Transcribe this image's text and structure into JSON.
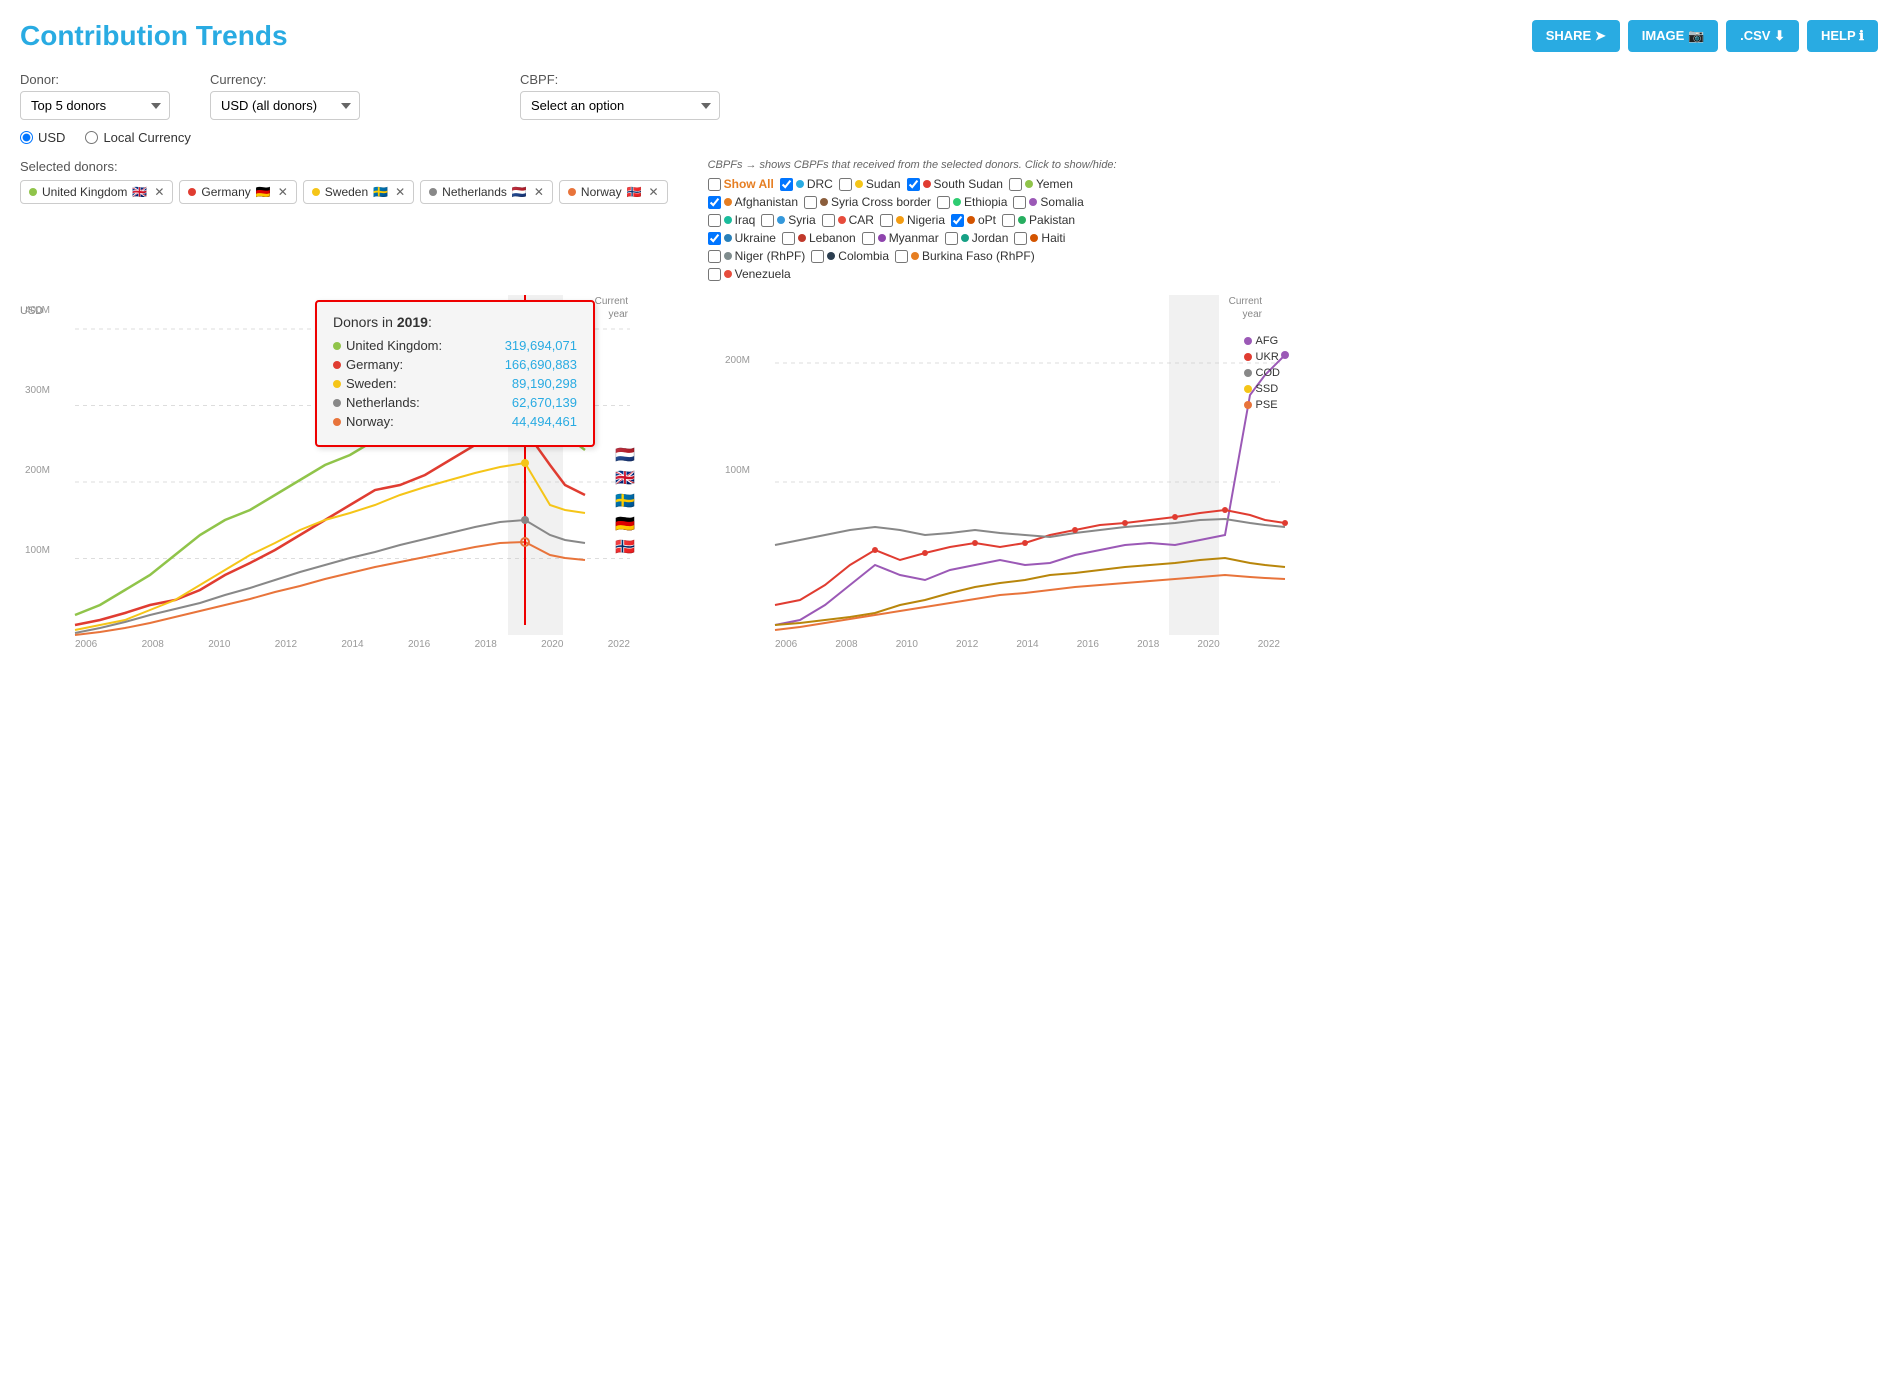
{
  "page": {
    "title": "Contribution Trends"
  },
  "header_buttons": [
    {
      "label": "SHARE",
      "icon": "share-icon",
      "name": "share-button"
    },
    {
      "label": "IMAGE",
      "icon": "image-icon",
      "name": "image-button"
    },
    {
      "label": ".CSV",
      "icon": "csv-icon",
      "name": "csv-button"
    },
    {
      "label": "HELP",
      "icon": "help-icon",
      "name": "help-button"
    }
  ],
  "controls": {
    "donor_label": "Donor:",
    "donor_value": "Top 5 donors",
    "currency_label": "Currency:",
    "currency_value": "USD (all donors)",
    "cbpf_label": "CBPF:",
    "cbpf_placeholder": "Select an option"
  },
  "radio": {
    "usd_label": "USD",
    "local_label": "Local Currency",
    "selected": "USD"
  },
  "selected_donors": {
    "label": "Selected donors:",
    "items": [
      {
        "name": "United Kingdom",
        "color": "#90C44A",
        "flag": "🇬🇧"
      },
      {
        "name": "Germany",
        "color": "#E03C31",
        "flag": "🇩🇪"
      },
      {
        "name": "Sweden",
        "color": "#F5C518",
        "flag": "🇸🇪"
      },
      {
        "name": "Netherlands",
        "color": "#888888",
        "flag": "🇳🇱"
      },
      {
        "name": "Norway",
        "color": "#E8743B",
        "flag": "🇳🇴"
      }
    ]
  },
  "cbpfs_section": {
    "label": "CBPFs → shows CBPFs that received from the selected donors. Click to show/hide:",
    "show_all_label": "Show All",
    "items": [
      {
        "name": "DRC",
        "color": "#29ABE2",
        "checked": true
      },
      {
        "name": "Sudan",
        "color": "#F5C518",
        "checked": false
      },
      {
        "name": "South Sudan",
        "color": "#E03C31",
        "checked": true
      },
      {
        "name": "Yemen",
        "color": "#90C44A",
        "checked": false
      },
      {
        "name": "Afghanistan",
        "color": "#E67E22",
        "checked": true
      },
      {
        "name": "Syria Cross border",
        "color": "#8B5E3C",
        "checked": false
      },
      {
        "name": "Ethiopia",
        "color": "#2ECC71",
        "checked": false
      },
      {
        "name": "Somalia",
        "color": "#9B59B6",
        "checked": false
      },
      {
        "name": "Iraq",
        "color": "#1ABC9C",
        "checked": false
      },
      {
        "name": "Syria",
        "color": "#3498DB",
        "checked": false
      },
      {
        "name": "CAR",
        "color": "#E74C3C",
        "checked": false
      },
      {
        "name": "Nigeria",
        "color": "#F39C12",
        "checked": false
      },
      {
        "name": "oPt",
        "color": "#D35400",
        "checked": true
      },
      {
        "name": "Pakistan",
        "color": "#27AE60",
        "checked": false
      },
      {
        "name": "Ukraine",
        "color": "#2980B9",
        "checked": true
      },
      {
        "name": "Lebanon",
        "color": "#C0392B",
        "checked": false
      },
      {
        "name": "Myanmar",
        "color": "#8E44AD",
        "checked": false
      },
      {
        "name": "Jordan",
        "color": "#16A085",
        "checked": false
      },
      {
        "name": "Haiti",
        "color": "#D35400",
        "checked": false
      },
      {
        "name": "Niger (RhPF)",
        "color": "#7F8C8D",
        "checked": false
      },
      {
        "name": "Colombia",
        "color": "#2C3E50",
        "checked": false
      },
      {
        "name": "Burkina Faso (RhPF)",
        "color": "#E67E22",
        "checked": false
      },
      {
        "name": "Venezuela",
        "color": "#E74C3C",
        "checked": false
      }
    ]
  },
  "chart_main": {
    "y_label": "USD",
    "y_ticks": [
      "400M",
      "300M",
      "200M",
      "100M"
    ],
    "x_ticks": [
      "2006",
      "2008",
      "2010",
      "2012",
      "2014",
      "2016",
      "2018",
      "2020",
      "2022"
    ],
    "current_year_label": "Current\nyear"
  },
  "tooltip": {
    "year": "2019",
    "prefix": "Donors in ",
    "donors": [
      {
        "name": "United Kingdom",
        "color": "#90C44A",
        "value": "319,694,071"
      },
      {
        "name": "Germany",
        "color": "#E03C31",
        "value": "166,690,883"
      },
      {
        "name": "Sweden",
        "color": "#F5C518",
        "value": "89,190,298"
      },
      {
        "name": "Netherlands",
        "color": "#888888",
        "value": "62,670,139"
      },
      {
        "name": "Norway",
        "color": "#E8743B",
        "value": "44,494,461"
      }
    ]
  },
  "chart_secondary": {
    "y_ticks": [
      "200M",
      "100M"
    ],
    "x_ticks": [
      "2006",
      "2008",
      "2010",
      "2012",
      "2014",
      "2016",
      "2018",
      "2020",
      "2022"
    ],
    "current_year_label": "Current\nyear",
    "legend": [
      {
        "label": "AFG",
        "color": "#9B59B6"
      },
      {
        "label": "UKR",
        "color": "#E03C31"
      },
      {
        "label": "COD",
        "color": "#888888"
      },
      {
        "label": "SSD",
        "color": "#F5C518"
      },
      {
        "label": "PSE",
        "color": "#E8743B"
      }
    ]
  }
}
